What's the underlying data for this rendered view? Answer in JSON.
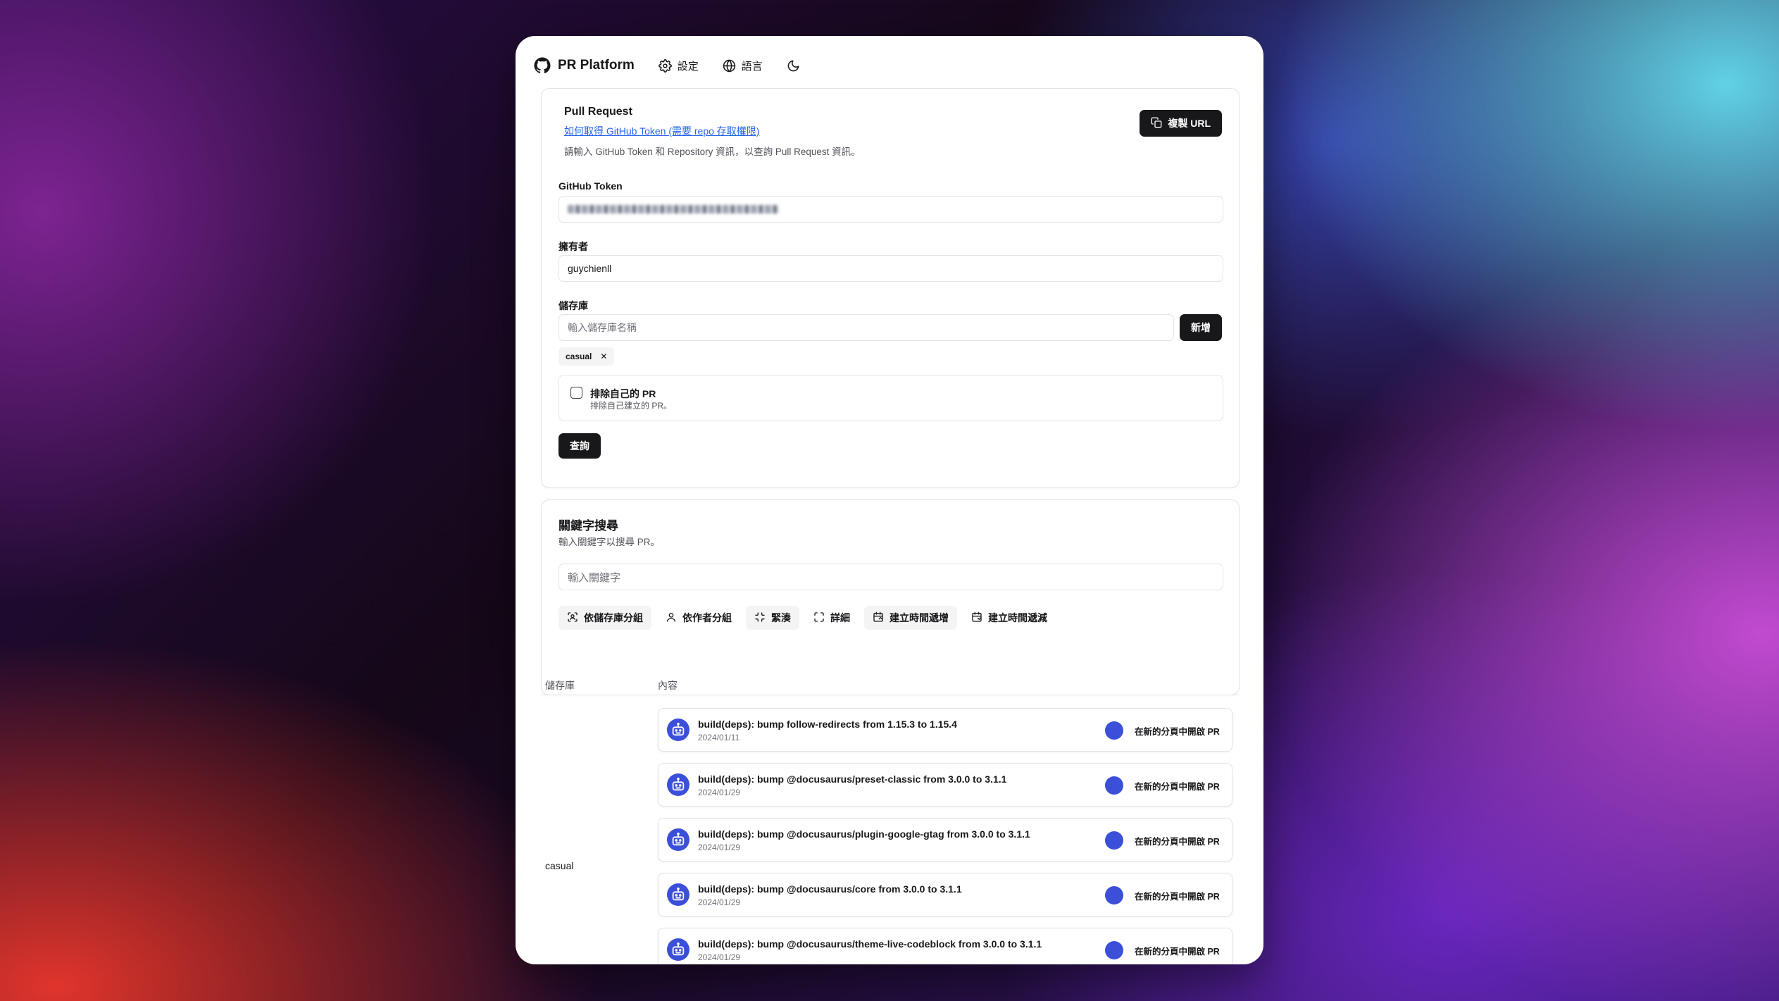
{
  "nav": {
    "brand": "PR Platform",
    "settings": "設定",
    "language": "語言"
  },
  "pr_card": {
    "title": "Pull Request",
    "token_link": "如何取得 GitHub Token (需要 repo 存取權限)",
    "description": "請輸入 GitHub Token 和 Repository 資訊，以查詢 Pull Request 資訊。",
    "copy_url": "複製 URL",
    "token_label": "GitHub Token",
    "owner_label": "擁有者",
    "owner_value": "guychienll",
    "repo_label": "儲存庫",
    "repo_placeholder": "輸入儲存庫名稱",
    "add_button": "新增",
    "repo_tags": [
      "casual"
    ],
    "exclude_title": "排除自己的 PR",
    "exclude_desc": "排除自己建立的 PR。",
    "query_button": "查詢"
  },
  "search_card": {
    "title": "關鍵字搜尋",
    "description": "輸入關鍵字以搜尋 PR。",
    "placeholder": "輸入關鍵字",
    "tools": [
      {
        "label": "依儲存庫分組",
        "icon": "group-repo-icon",
        "active": true
      },
      {
        "label": "依作者分組",
        "icon": "user-icon",
        "active": false
      },
      {
        "label": "緊湊",
        "icon": "compress-icon",
        "active": true
      },
      {
        "label": "詳細",
        "icon": "expand-icon",
        "active": false
      },
      {
        "label": "建立時間遞增",
        "icon": "calendar-asc-icon",
        "active": true
      },
      {
        "label": "建立時間遞減",
        "icon": "calendar-desc-icon",
        "active": false
      }
    ]
  },
  "table": {
    "col_repo": "儲存庫",
    "col_content": "內容",
    "repo_name": "casual",
    "rows": [
      {
        "title": "build(deps): bump follow-redirects from 1.15.3 to 1.15.4",
        "date": "2024/01/11",
        "action": "在新的分頁中開啟 PR"
      },
      {
        "title": "build(deps): bump @docusaurus/preset-classic from 3.0.0 to 3.1.1",
        "date": "2024/01/29",
        "action": "在新的分頁中開啟 PR"
      },
      {
        "title": "build(deps): bump @docusaurus/plugin-google-gtag from 3.0.0 to 3.1.1",
        "date": "2024/01/29",
        "action": "在新的分頁中開啟 PR"
      },
      {
        "title": "build(deps): bump @docusaurus/core from 3.0.0 to 3.1.1",
        "date": "2024/01/29",
        "action": "在新的分頁中開啟 PR"
      },
      {
        "title": "build(deps): bump @docusaurus/theme-live-codeblock from 3.0.0 to 3.1.1",
        "date": "2024/01/29",
        "action": "在新的分頁中開啟 PR"
      }
    ]
  },
  "colors": {
    "primary_button": "#18181b",
    "link": "#2563eb",
    "avatar_bg": "#3b4fd8"
  }
}
